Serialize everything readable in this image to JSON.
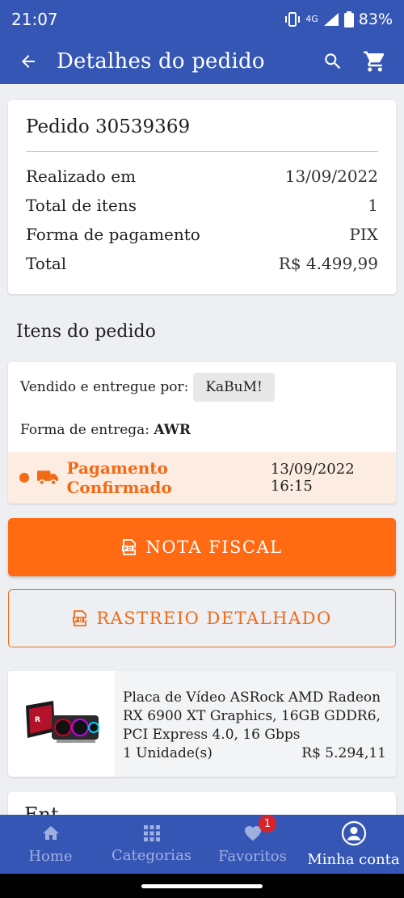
{
  "status_bar": {
    "time": "21:07",
    "network": "4G",
    "battery": "83%"
  },
  "app_bar": {
    "title": "Detalhes do pedido",
    "back_icon": "arrow-left-icon",
    "search_icon": "search-icon",
    "cart_icon": "cart-icon"
  },
  "order": {
    "title": "Pedido 30539369",
    "rows": [
      {
        "label": "Realizado em",
        "value": "13/09/2022"
      },
      {
        "label": "Total de itens",
        "value": "1"
      },
      {
        "label": "Forma de pagamento",
        "value": "PIX"
      },
      {
        "label": "Total",
        "value": "R$ 4.499,99"
      }
    ]
  },
  "items_section": {
    "title": "Itens do pedido",
    "seller_label": "Vendido e entregue por:",
    "seller_name": "KaBuM!",
    "delivery_label": "Forma de entrega:",
    "delivery_value": "AWR",
    "status_text": "Pagamento Confirmado",
    "status_date": "13/09/2022 16:15"
  },
  "buttons": {
    "nota_fiscal": "NOTA FISCAL",
    "rastreio": "RASTREIO DETALHADO"
  },
  "product": {
    "name": "Placa de Vídeo ASRock AMD Radeon RX 6900 XT Graphics, 16GB GDDR6, PCI Express 4.0, 16 Gbps",
    "quantity": "1 Unidade(s)",
    "price": "R$ 5.294,11"
  },
  "peek_text": "Ent",
  "bottom_nav": {
    "items": [
      {
        "label": "Home",
        "icon": "home-icon"
      },
      {
        "label": "Categorias",
        "icon": "categories-icon"
      },
      {
        "label": "Favoritos",
        "icon": "heart-icon",
        "badge": "1"
      },
      {
        "label": "Minha conta",
        "icon": "account-icon"
      }
    ],
    "active": "Minha conta"
  },
  "colors": {
    "primary": "#3656b5",
    "accent": "#ff6a13",
    "badge": "#d8232a"
  }
}
